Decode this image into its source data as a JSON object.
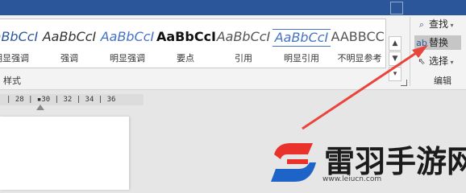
{
  "ribbon": {
    "styles": [
      {
        "preview": "AaBbCcI",
        "name": "明显强调",
        "color": "#2b579a",
        "italic": true,
        "bold": false,
        "underline": false
      },
      {
        "preview": "AaBbCcI",
        "name": "强调",
        "color": "#333333",
        "italic": true,
        "bold": false,
        "underline": false
      },
      {
        "preview": "AaBbCcI",
        "name": "明显强调",
        "color": "#4472c4",
        "italic": true,
        "bold": false,
        "underline": false
      },
      {
        "preview": "AaBbCcI",
        "name": "要点",
        "color": "#111111",
        "italic": false,
        "bold": true,
        "underline": false
      },
      {
        "preview": "AaBbCcI",
        "name": "引用",
        "color": "#555555",
        "italic": true,
        "bold": false,
        "underline": false
      },
      {
        "preview": "AaBbCcI",
        "name": "明显引用",
        "color": "#4472c4",
        "italic": true,
        "bold": false,
        "underline": true
      },
      {
        "preview": "AABBCCI",
        "name": "不明显参考",
        "color": "#555555",
        "italic": false,
        "bold": false,
        "underline": false
      }
    ],
    "styles_group_label": "样式",
    "editing_group_label": "编辑",
    "editing": {
      "find": "查找",
      "replace": "替换",
      "select": "选择"
    }
  },
  "ruler": {
    "text": "| 28 | ▪30 | 32 | 34 | 36"
  },
  "logo": {
    "name": "雷羽手游网",
    "url": "www.leiucn.com"
  },
  "colors": {
    "accent": "#2b579a",
    "arrow": "#e8453c",
    "logo_red": "#e8322b",
    "logo_blue": "#1e63c8"
  }
}
